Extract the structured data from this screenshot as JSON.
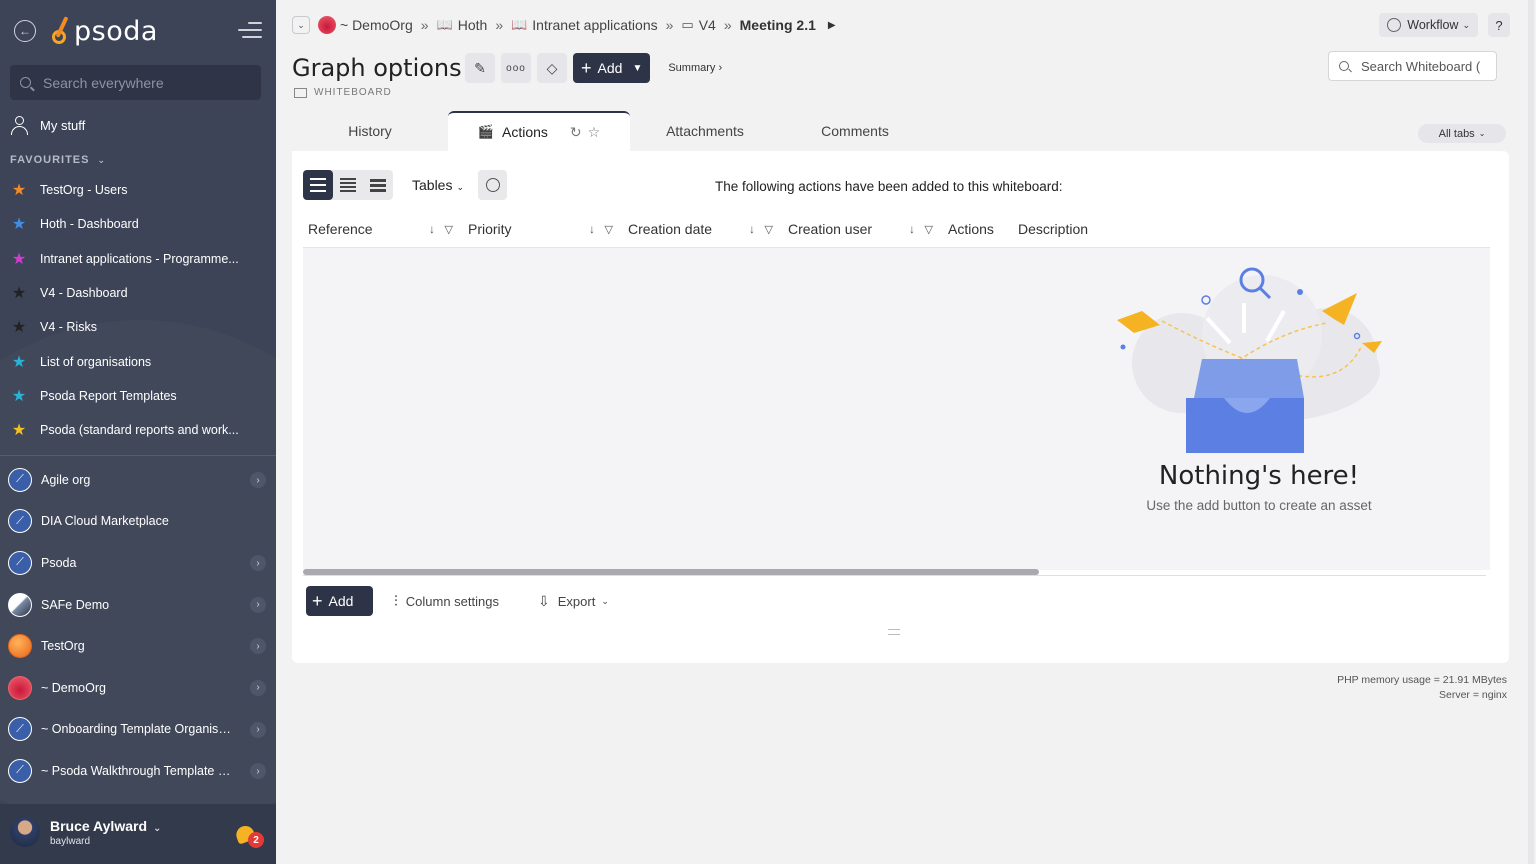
{
  "sidebar": {
    "brand": "psoda",
    "search_placeholder": "Search everywhere",
    "my_stuff": "My stuff",
    "favourites_title": "FAVOURITES",
    "favourites": [
      {
        "label": "TestOrg - Users",
        "color": "#f58a23"
      },
      {
        "label": "Hoth - Dashboard",
        "color": "#3f8ee8"
      },
      {
        "label": "Intranet applications - Programme...",
        "color": "#d63ad0"
      },
      {
        "label": "V4 - Dashboard",
        "color": "#222222"
      },
      {
        "label": "V4 - Risks",
        "color": "#222222"
      },
      {
        "label": "List of organisations",
        "color": "#2ab3d8"
      },
      {
        "label": "Psoda Report Templates",
        "color": "#2ab3d8"
      },
      {
        "label": "Psoda (standard reports and work...",
        "color": "#f5c023"
      }
    ],
    "orgs": [
      {
        "label": "Agile org",
        "logo": "rocket",
        "has_children": true
      },
      {
        "label": "DIA Cloud Marketplace",
        "logo": "rocket",
        "has_children": false
      },
      {
        "label": "Psoda",
        "logo": "rocket",
        "has_children": true
      },
      {
        "label": "SAFe Demo",
        "logo": "safe",
        "has_children": true
      },
      {
        "label": "TestOrg",
        "logo": "test",
        "has_children": true
      },
      {
        "label": "~ DemoOrg",
        "logo": "demo",
        "has_children": true
      },
      {
        "label": "~ Onboarding Template Organisa...",
        "logo": "rocket",
        "has_children": true
      },
      {
        "label": "~ Psoda Walkthrough Template P...",
        "logo": "rocket",
        "has_children": true
      }
    ],
    "user": {
      "name": "Bruce Aylward",
      "login": "baylward",
      "notifications": "2"
    }
  },
  "breadcrumbs": [
    {
      "label": "~ DemoOrg",
      "icon": "org-logo"
    },
    {
      "label": "Hoth",
      "icon": "book-icon"
    },
    {
      "label": "Intranet applications",
      "icon": "book-icon"
    },
    {
      "label": "V4",
      "icon": "folder-icon"
    },
    {
      "label": "Meeting 2.1",
      "icon": ""
    }
  ],
  "header": {
    "workflow_label": "Workflow",
    "help_label": "?",
    "title": "Graph options",
    "subtitle": "WHITEBOARD",
    "add_label": "Add",
    "summary_label": "Summary ›",
    "search_placeholder": "Search Whiteboard ("
  },
  "tabs": [
    {
      "label": "History",
      "active": false
    },
    {
      "label": "Actions",
      "active": true
    },
    {
      "label": "Attachments",
      "active": false
    },
    {
      "label": "Comments",
      "active": false
    }
  ],
  "all_tabs_label": "All tabs",
  "panel": {
    "tables_label": "Tables",
    "message": "The following actions have been added to this whiteboard:",
    "columns": [
      {
        "label": "Reference",
        "sortable": true
      },
      {
        "label": "Priority",
        "sortable": true
      },
      {
        "label": "Creation date",
        "sortable": true
      },
      {
        "label": "Creation user",
        "sortable": true
      },
      {
        "label": "Actions",
        "sortable": false
      },
      {
        "label": "Description",
        "sortable": false
      }
    ],
    "empty_title": "Nothing's here!",
    "empty_sub": "Use the add button to create an asset",
    "add_label": "Add",
    "column_settings_label": "Column settings",
    "export_label": "Export"
  },
  "footer": {
    "memory": "PHP memory usage = 21.91 MBytes",
    "server": "Server = nginx"
  },
  "colors": {
    "sidebar_bg": "#3d4457",
    "primary_btn": "#2e3447",
    "illustration_blue": "#5b7fe3",
    "illustration_yellow": "#f5b323"
  }
}
